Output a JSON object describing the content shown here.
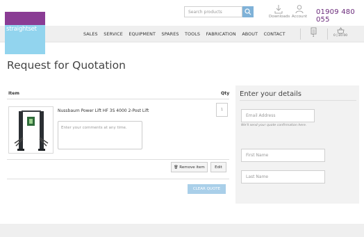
{
  "logo": {
    "text": "straightset"
  },
  "search": {
    "placeholder": "Search products"
  },
  "header_tools": {
    "downloads": "Downloads",
    "account": "Account"
  },
  "phone": "01909 480 055",
  "nav": {
    "items": [
      "SALES",
      "SERVICE",
      "EQUIPMENT",
      "SPARES",
      "TOOLS",
      "FABRICATION",
      "ABOUT",
      "CONTACT"
    ]
  },
  "quote_badge": {
    "count": "1"
  },
  "basket": {
    "summary": "0 | £0.00"
  },
  "page_title": "Request for Quotation",
  "table": {
    "col_item": "Item",
    "col_qty": "Qty"
  },
  "product": {
    "name": "Nussbaum Power Lift HF 3S 4000 2-Post Lift",
    "qty": "1"
  },
  "comments": {
    "placeholder": "Enter your comments at any time."
  },
  "actions": {
    "remove": "Remove item",
    "edit": "Edit",
    "clear": "CLEAR QUOTE"
  },
  "details": {
    "title": "Enter your details",
    "email_placeholder": "Email Address",
    "email_hint": "We'll send your quote confirmation here.",
    "first_name_placeholder": "First Name",
    "last_name_placeholder": "Last Name"
  },
  "colors": {
    "brand_purple": "#8a3c94",
    "brand_blue": "#92d4ee",
    "accent": "#7fb2d8"
  }
}
